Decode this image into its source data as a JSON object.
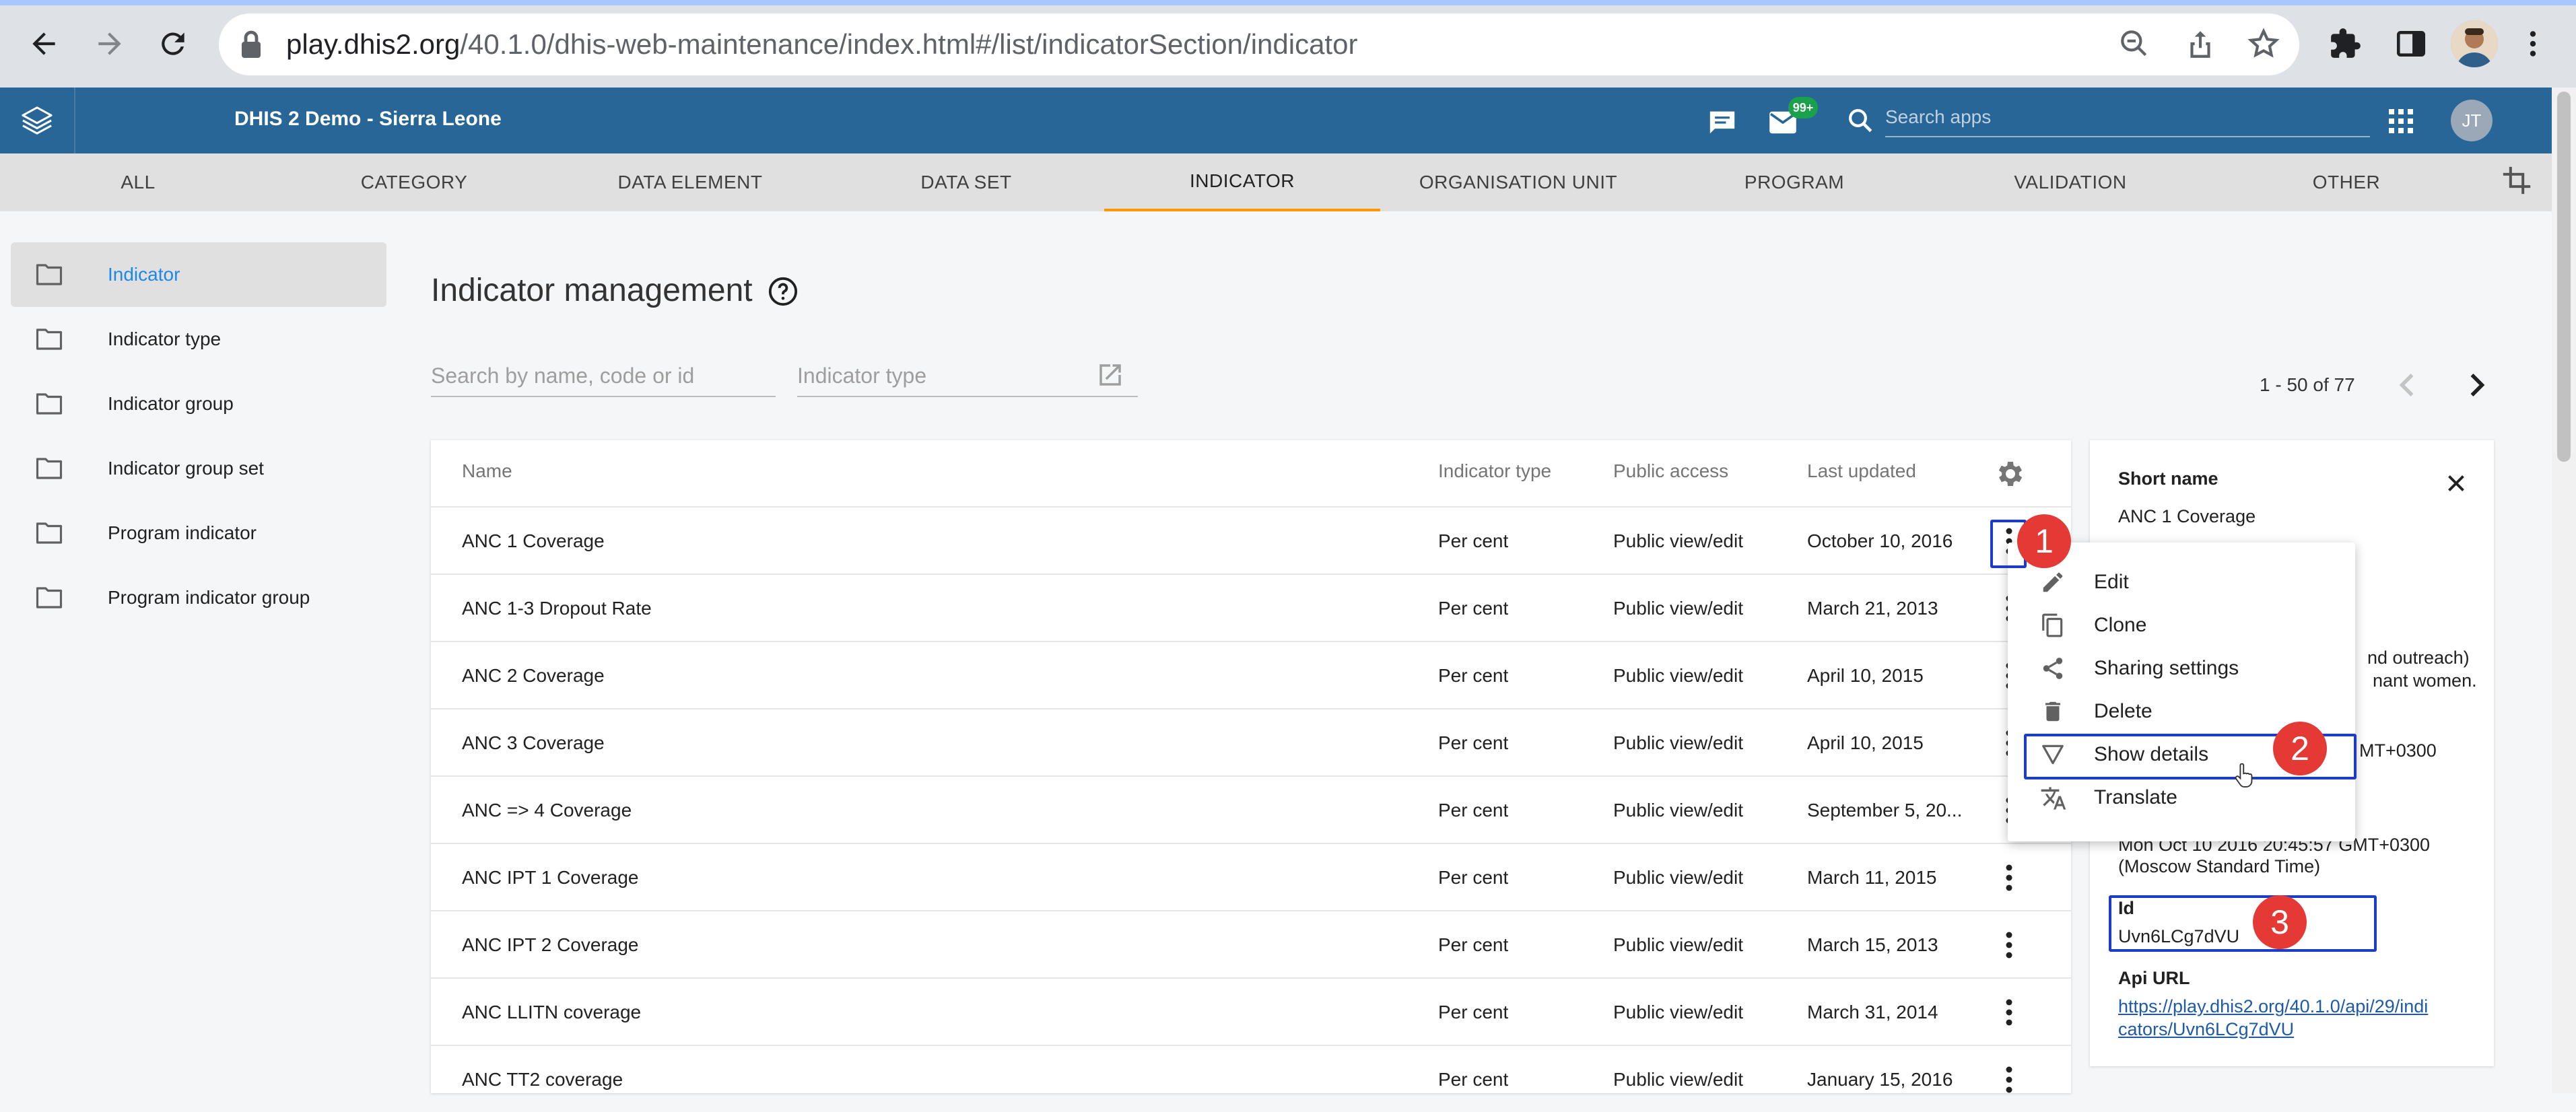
{
  "browser": {
    "url_host": "play.dhis2.org",
    "url_path": "/40.1.0/dhis-web-maintenance/index.html#/list/indicatorSection/indicator"
  },
  "header": {
    "title": "DHIS 2 Demo - Sierra Leone",
    "messages_badge": "99+",
    "search_placeholder": "Search apps",
    "user_initials": "JT"
  },
  "tabs": [
    "ALL",
    "CATEGORY",
    "DATA ELEMENT",
    "DATA SET",
    "INDICATOR",
    "ORGANISATION UNIT",
    "PROGRAM",
    "VALIDATION",
    "OTHER"
  ],
  "active_tab": "INDICATOR",
  "sidebar": {
    "items": [
      "Indicator",
      "Indicator type",
      "Indicator group",
      "Indicator group set",
      "Program indicator",
      "Program indicator group"
    ],
    "active": "Indicator"
  },
  "main": {
    "title": "Indicator management",
    "search_placeholder": "Search by name, code or id",
    "type_placeholder": "Indicator type",
    "pager": "1 - 50 of 77"
  },
  "table": {
    "columns": [
      "Name",
      "Indicator type",
      "Public access",
      "Last updated"
    ],
    "rows": [
      [
        "ANC 1 Coverage",
        "Per cent",
        "Public view/edit",
        "October 10, 2016"
      ],
      [
        "ANC 1-3 Dropout Rate",
        "Per cent",
        "Public view/edit",
        "March 21, 2013"
      ],
      [
        "ANC 2 Coverage",
        "Per cent",
        "Public view/edit",
        "April 10, 2015"
      ],
      [
        "ANC 3 Coverage",
        "Per cent",
        "Public view/edit",
        "April 10, 2015"
      ],
      [
        "ANC => 4 Coverage",
        "Per cent",
        "Public view/edit",
        "September 5, 20..."
      ],
      [
        "ANC IPT 1 Coverage",
        "Per cent",
        "Public view/edit",
        "March 11, 2015"
      ],
      [
        "ANC IPT 2 Coverage",
        "Per cent",
        "Public view/edit",
        "March 15, 2013"
      ],
      [
        "ANC LLITN coverage",
        "Per cent",
        "Public view/edit",
        "March 31, 2014"
      ],
      [
        "ANC TT2 coverage",
        "Per cent",
        "Public view/edit",
        "January 15, 2016"
      ]
    ]
  },
  "menu": {
    "items": [
      "Edit",
      "Clone",
      "Sharing settings",
      "Delete",
      "Show details",
      "Translate"
    ]
  },
  "details": {
    "short_name_label": "Short name",
    "short_name": "ANC 1 Coverage",
    "desc_frag1": "nd outreach)",
    "desc_frag2": "nant women.",
    "created_frag": "MT+0300",
    "last_updated_line1": "Mon Oct 10 2016 20:45:57 GMT+0300",
    "last_updated_line2": "(Moscow Standard Time)",
    "id_label": "Id",
    "id_value": "Uvn6LCg7dVU",
    "api_label": "Api URL",
    "api_line1": "https://play.dhis2.org/40.1.0/api/29/indi",
    "api_line2": "cators/Uvn6LCg7dVU"
  },
  "annotations": [
    "1",
    "2",
    "3"
  ]
}
